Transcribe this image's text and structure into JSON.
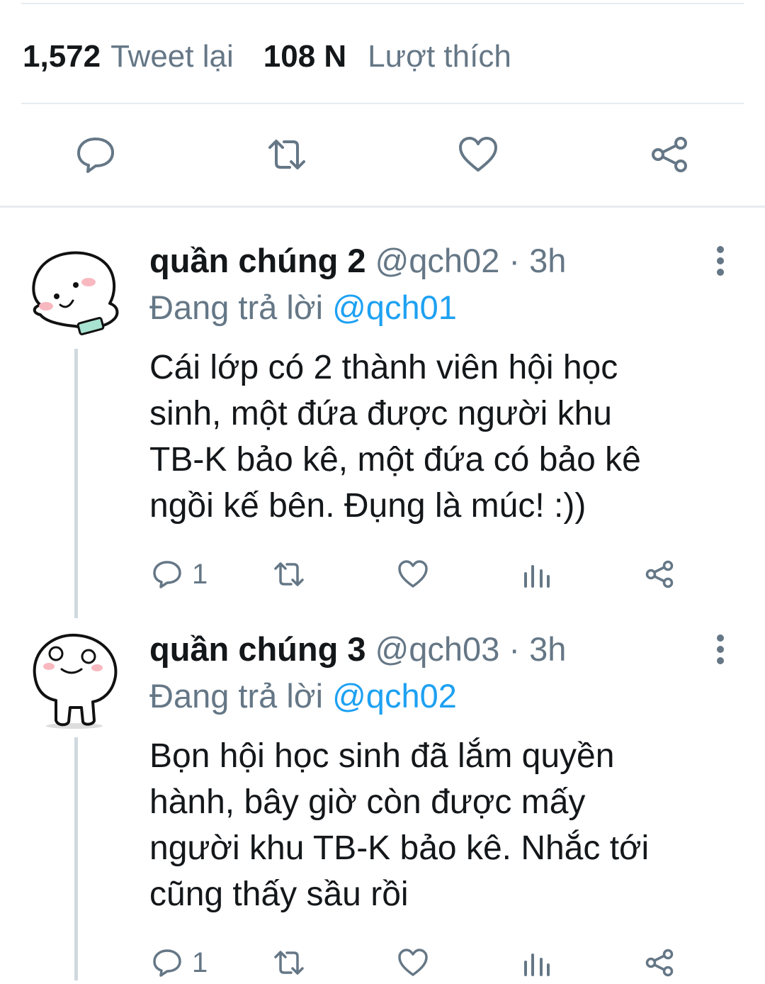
{
  "stats": {
    "retweets_count": "1,572",
    "retweets_label": "Tweet lại",
    "likes_count": "108 N",
    "likes_label": "Lượt thích"
  },
  "main_actions": {
    "reply_icon": "reply-icon",
    "retweet_icon": "retweet-icon",
    "like_icon": "heart-icon",
    "share_icon": "share-icon"
  },
  "replies": [
    {
      "name": "quần chúng 2",
      "handle": "@qch02",
      "separator": "·",
      "time": "3h",
      "replying_prefix": "Đang trả lời",
      "replying_to": "@qch01",
      "text_lines": [
        "Cái lớp có 2 thành viên hội học",
        "sinh, một đứa được người khu",
        "TB-K bảo kê, một đứa có bảo kê",
        "ngồi kế bên. Đụng là múc! :))"
      ],
      "reply_count": "1"
    },
    {
      "name": "quần chúng 3",
      "handle": "@qch03",
      "separator": "·",
      "time": "3h",
      "replying_prefix": "Đang trả lời",
      "replying_to": "@qch02",
      "text_lines": [
        "Bọn hội học sinh đã lắm quyền",
        "hành, bây giờ còn được mấy",
        "người khu TB-K bảo kê. Nhắc tới",
        "cũng thấy sầu rồi"
      ],
      "reply_count": "1"
    }
  ],
  "colors": {
    "text": "#14171a",
    "secondary": "#657786",
    "mention": "#1da1f2",
    "divider": "#e6ecf0"
  }
}
